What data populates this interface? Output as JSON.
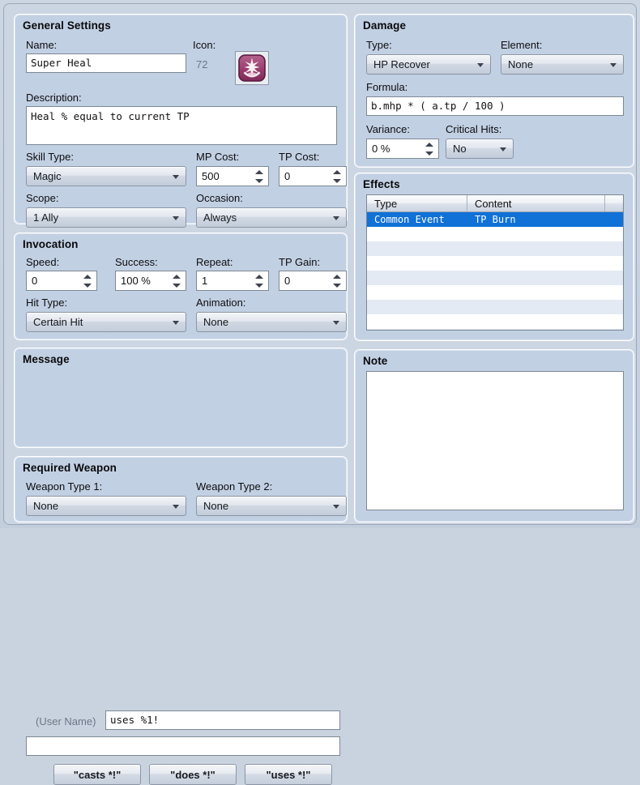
{
  "colors": {
    "panel_bg": "#c2d0e4",
    "window_bg": "#ccd6e3",
    "selection": "#1071d6",
    "icon_accent": "#9b3d6e"
  },
  "general": {
    "title": "General Settings",
    "name_label": "Name:",
    "name_value": "Super Heal",
    "icon_label": "Icon:",
    "icon_index": "72",
    "icon_name": "recovery-sparkle-icon",
    "description_label": "Description:",
    "description_value": "Heal % equal to current TP",
    "skill_type_label": "Skill Type:",
    "skill_type_value": "Magic",
    "mp_cost_label": "MP Cost:",
    "mp_cost_value": "500",
    "tp_cost_label": "TP Cost:",
    "tp_cost_value": "0",
    "scope_label": "Scope:",
    "scope_value": "1 Ally",
    "occasion_label": "Occasion:",
    "occasion_value": "Always"
  },
  "invocation": {
    "title": "Invocation",
    "speed_label": "Speed:",
    "speed_value": "0",
    "success_label": "Success:",
    "success_value": "100 %",
    "repeat_label": "Repeat:",
    "repeat_value": "1",
    "tp_gain_label": "TP Gain:",
    "tp_gain_value": "0",
    "hit_type_label": "Hit Type:",
    "hit_type_value": "Certain Hit",
    "animation_label": "Animation:",
    "animation_value": "None"
  },
  "message": {
    "title": "Message",
    "user_name_label": "(User Name)",
    "line1_value": "uses %1!",
    "line2_value": "",
    "buttons": [
      "\"casts *!\"",
      "\"does *!\"",
      "\"uses *!\""
    ]
  },
  "required_weapon": {
    "title": "Required Weapon",
    "weapon1_label": "Weapon Type 1:",
    "weapon1_value": "None",
    "weapon2_label": "Weapon Type 2:",
    "weapon2_value": "None"
  },
  "damage": {
    "title": "Damage",
    "type_label": "Type:",
    "type_value": "HP Recover",
    "element_label": "Element:",
    "element_value": "None",
    "formula_label": "Formula:",
    "formula_value": "b.mhp * ( a.tp / 100 )",
    "variance_label": "Variance:",
    "variance_value": "0 %",
    "critical_label": "Critical Hits:",
    "critical_value": "No"
  },
  "effects": {
    "title": "Effects",
    "columns": [
      "Type",
      "Content",
      ""
    ],
    "rows": [
      {
        "type": "Common Event",
        "content": "TP Burn",
        "selected": true
      },
      {
        "type": "",
        "content": "",
        "selected": false
      },
      {
        "type": "",
        "content": "",
        "selected": false
      },
      {
        "type": "",
        "content": "",
        "selected": false
      },
      {
        "type": "",
        "content": "",
        "selected": false
      },
      {
        "type": "",
        "content": "",
        "selected": false
      },
      {
        "type": "",
        "content": "",
        "selected": false
      },
      {
        "type": "",
        "content": "",
        "selected": false
      },
      {
        "type": "",
        "content": "",
        "selected": false
      }
    ]
  },
  "note": {
    "title": "Note",
    "value": ""
  }
}
